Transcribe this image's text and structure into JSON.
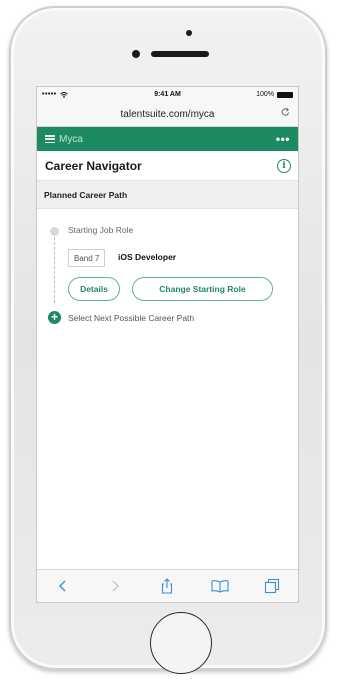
{
  "status_bar": {
    "signal": "•••••",
    "time": "9:41 AM",
    "battery": "100%"
  },
  "browser": {
    "url": "talentsuite.com/myca",
    "reload_icon": "reload-icon"
  },
  "app_header": {
    "app_name": "Myca",
    "more": "•••"
  },
  "page": {
    "title": "Career Navigator"
  },
  "section": {
    "title": "Planned Career Path"
  },
  "career_path": {
    "starting_label": "Starting Job Role",
    "band": "Band 7",
    "role": "iOS Developer",
    "details_button": "Details",
    "change_button": "Change Starting Role",
    "next_label": "Select Next Possible Career Path"
  },
  "toolbar": {
    "icons": [
      "back-icon",
      "forward-icon",
      "share-icon",
      "bookmarks-icon",
      "tabs-icon"
    ]
  },
  "colors": {
    "accent": "#1d8a62",
    "pill_border": "#5bb58f"
  }
}
